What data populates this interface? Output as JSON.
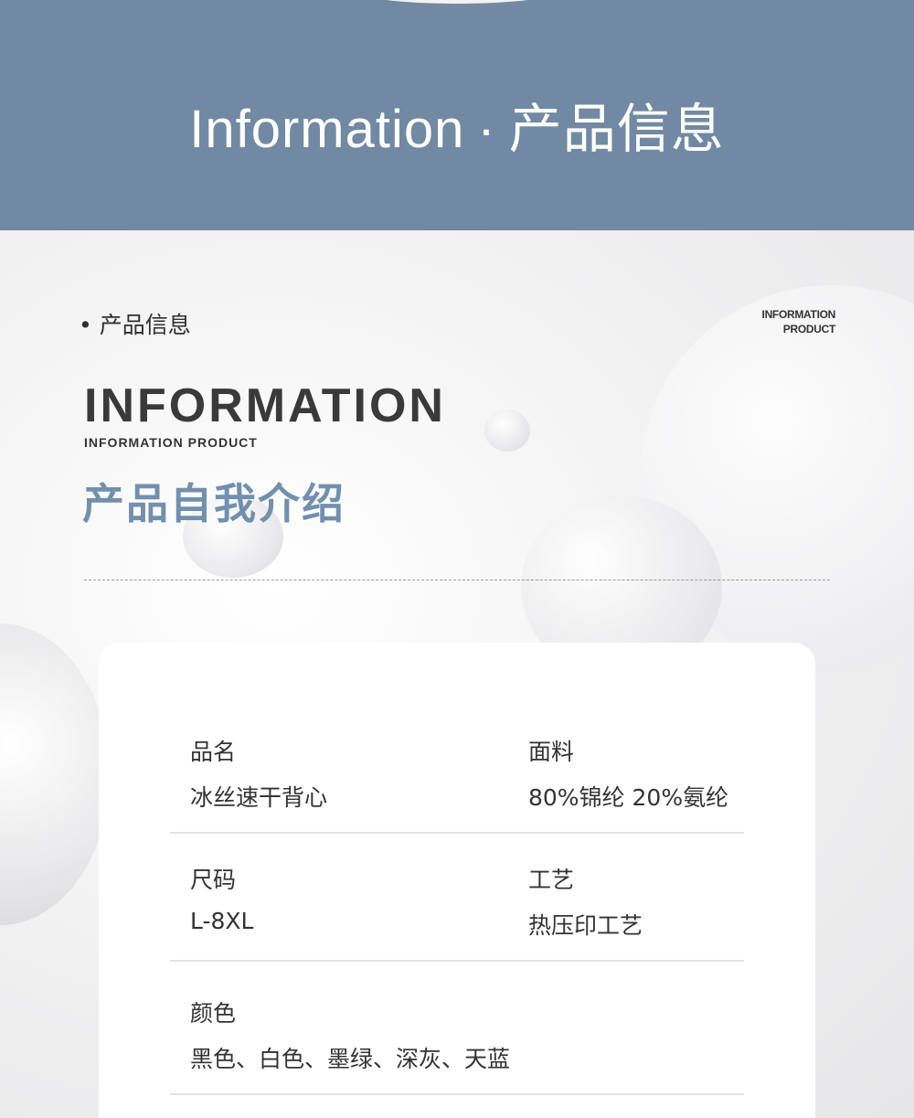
{
  "banner": {
    "title_en": "Information",
    "separator": "·",
    "title_cn": "产品信息"
  },
  "section": {
    "bullet_label": "• 产品信息",
    "corner_line1": "INFORMATION",
    "corner_line2": "PRODUCT",
    "big_title": "INFORMATION",
    "sub_title": "INFORMATION PRODUCT",
    "cn_title": "产品自我介绍"
  },
  "details": {
    "name_label": "品名",
    "name_value": "冰丝速干背心",
    "fabric_label": "面料",
    "fabric_value": "80%锦纶 20%氨纶",
    "size_label": "尺码",
    "size_value": "L-8XL",
    "craft_label": "工艺",
    "craft_value": "热压印工艺",
    "color_label": "颜色",
    "color_value": "黑色、白色、墨绿、深灰、天蓝"
  },
  "colors": {
    "banner": "#7289a3",
    "accent": "#7290ad"
  }
}
